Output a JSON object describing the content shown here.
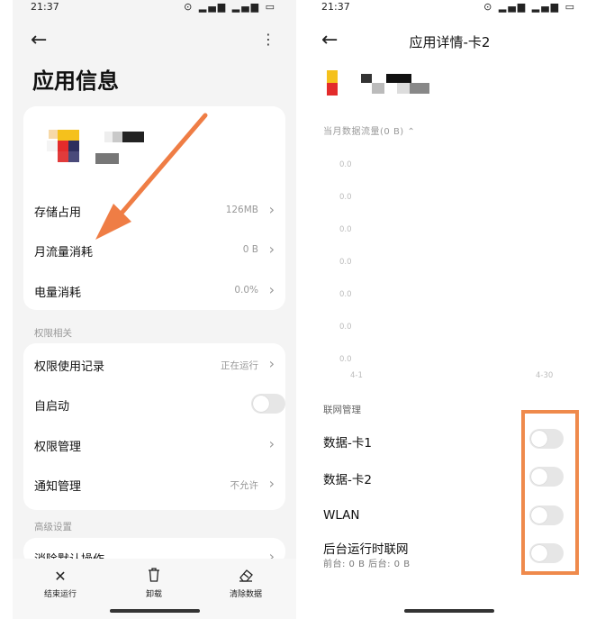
{
  "left": {
    "status_time": "21:37",
    "status_icons": "⊙ ▂▄▆ ▂▄▆ ▭",
    "title": "应用信息",
    "rows": [
      {
        "label": "存储占用",
        "value": "126MB"
      },
      {
        "label": "月流量消耗",
        "value": "0 B"
      },
      {
        "label": "电量消耗",
        "value": "0.0%"
      }
    ],
    "section_permissions": "权限相关",
    "perm_rows": [
      {
        "label": "权限使用记录",
        "value": "正在运行"
      },
      {
        "label": "自启动",
        "value": ""
      },
      {
        "label": "权限管理",
        "value": ""
      },
      {
        "label": "通知管理",
        "value": "不允许"
      }
    ],
    "section_advanced": "高级设置",
    "advanced_row": "消除默认操作",
    "bottom_bar": [
      {
        "label": "结束运行",
        "icon": "close-icon"
      },
      {
        "label": "卸载",
        "icon": "trash-icon"
      },
      {
        "label": "清除数据",
        "icon": "eraser-icon"
      }
    ]
  },
  "right": {
    "status_time": "21:37",
    "status_icons": "⊙ ▂▄▆ ▂▄▆ ▭",
    "title": "应用详情-卡2",
    "flow_label": "当月数据流量(0 B) ⌃",
    "chart_data": {
      "type": "line",
      "x": [
        "4-1",
        "4-30"
      ],
      "y_ticks": [
        "0.0",
        "0.0",
        "0.0",
        "0.0",
        "0.0",
        "0.0",
        "0.0"
      ],
      "values": [
        0,
        0
      ]
    },
    "net_section": "联网管理",
    "net_rows": [
      {
        "label": "数据-卡1",
        "enabled": false
      },
      {
        "label": "数据-卡2",
        "enabled": false
      },
      {
        "label": "WLAN",
        "enabled": false
      },
      {
        "label": "后台运行时联网",
        "enabled": false
      }
    ],
    "bg_sub": "前台: 0 B  后台: 0 B"
  },
  "colors": {
    "highlight": "#ef8a4c",
    "arrow": "#ef7d45"
  }
}
